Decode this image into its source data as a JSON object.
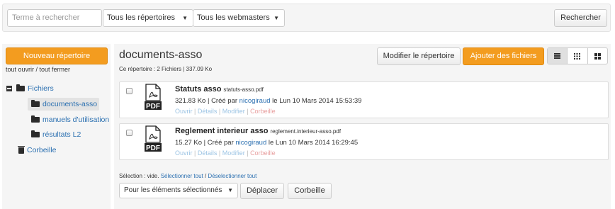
{
  "search": {
    "placeholder": "Terme à rechercher",
    "folder_filter": "Tous les répertoires",
    "webmaster_filter": "Tous les webmasters",
    "submit_label": "Rechercher"
  },
  "sidebar": {
    "new_folder_label": "Nouveau répertoire",
    "toggle_all_label": "tout ouvrir / tout fermer",
    "tree": {
      "root": "Fichiers",
      "children": [
        "documents-asso",
        "manuels d'utilisation",
        "résultats L2"
      ],
      "active": "documents-asso"
    },
    "trash_label": "Corbeille"
  },
  "main": {
    "title": "documents-asso",
    "info": "Ce répertoire : 2 Fichiers | 337.09 Ko",
    "edit_folder_label": "Modifier le répertoire",
    "add_files_label": "Ajouter des fichiers",
    "view_modes": [
      "list-view-icon",
      "grid-small-icon",
      "grid-large-icon"
    ],
    "active_view": "list-view-icon",
    "files": [
      {
        "title": "Statuts asso",
        "filename": "statuts-asso.pdf",
        "meta_prefix": "321.83 Ko | Créé par ",
        "author": "nicogiraud",
        "meta_suffix": " le Lun 10 Mars 2014 15:53:39",
        "actions": [
          "Ouvrir",
          "Détails",
          "Modifier",
          "Corbeille"
        ]
      },
      {
        "title": "Reglement interieur asso",
        "filename": "reglement.interieur-asso.pdf",
        "meta_prefix": "15.27 Ko | Créé par ",
        "author": "nicogiraud",
        "meta_suffix": " le Lun 10 Mars 2014 16:29:45",
        "actions": [
          "Ouvrir",
          "Détails",
          "Modifier",
          "Corbeille"
        ]
      }
    ],
    "pdf_icon_text": "PDF",
    "selection": {
      "prefix": "Sélection : vide. ",
      "select_all": "Sélectionner tout",
      "separator": " / ",
      "deselect_all": "Déselectionner tout",
      "bulk_action": "Pour les éléments sélectionnés",
      "move_label": "Déplacer",
      "trash_label": "Corbeille"
    }
  },
  "colors": {
    "accent": "#f39c1f",
    "link": "#2a6fb0",
    "panel": "#f5f5f5"
  }
}
